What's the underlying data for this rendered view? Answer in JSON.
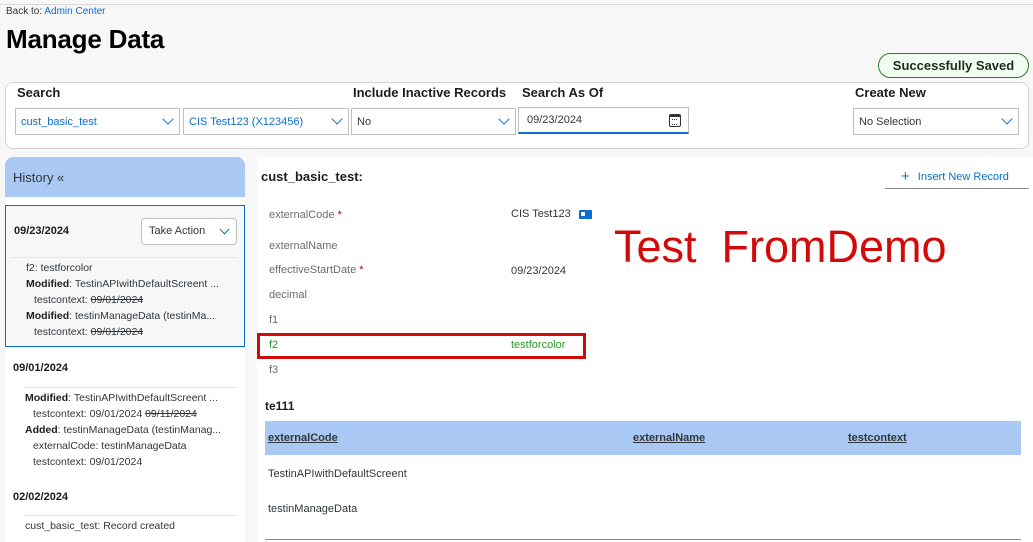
{
  "header": {
    "back_prefix": "Back to:",
    "back_link": "Admin Center",
    "title": "Manage Data",
    "status_badge": "Successfully Saved"
  },
  "search": {
    "search_label": "Search",
    "object_type": "cust_basic_test",
    "object_instance": "CIS Test123 (X123456)",
    "inactive_label": "Include Inactive Records",
    "inactive_value": "No",
    "asof_label": "Search As Of",
    "asof_value": "09/23/2024",
    "create_label": "Create New",
    "create_value": "No Selection"
  },
  "history": {
    "header": "History «",
    "take_action": "Take Action",
    "entries": [
      {
        "date": "09/23/2024",
        "lines": [
          {
            "text": "f2: testforcolor"
          },
          {
            "bold": "Modified",
            "text": ": TestinAPIwithDefaultScreent ..."
          },
          {
            "text": "testcontext: ",
            "strike": "09/01/2024"
          },
          {
            "bold": "Modified",
            "text": ": testinManageData (testinMa..."
          },
          {
            "text": "testcontext: ",
            "strike": "09/01/2024"
          }
        ]
      },
      {
        "date": "09/01/2024",
        "lines": [
          {
            "bold": "Modified",
            "text": ": TestinAPIwithDefaultScreent ..."
          },
          {
            "text": "testcontext: 09/01/2024 ",
            "strike": "09/11/2024"
          },
          {
            "bold": "Added",
            "text": ": testinManageData (testinManag..."
          },
          {
            "text": "externalCode: testinManageData"
          },
          {
            "text": "testcontext: 09/01/2024"
          }
        ]
      },
      {
        "date": "02/02/2024",
        "lines": [
          {
            "text": "cust_basic_test: Record created"
          }
        ]
      }
    ]
  },
  "record": {
    "title": "cust_basic_test:",
    "insert_button": "Insert New Record",
    "fields": [
      {
        "label": "externalCode",
        "required": "*",
        "value": "CIS Test123"
      },
      {
        "label": "externalName",
        "value": ""
      },
      {
        "label": "effectiveStartDate",
        "required": "*",
        "value": "09/23/2024"
      },
      {
        "label": "decimal",
        "value": ""
      },
      {
        "label": "f1",
        "value": ""
      },
      {
        "label": "f2",
        "value": "testforcolor"
      },
      {
        "label": "f3",
        "value": ""
      }
    ],
    "overlay_text": "Test  FromDemo"
  },
  "child_table": {
    "title": "te111",
    "columns": [
      "externalCode",
      "externalName",
      "testcontext"
    ],
    "rows": [
      [
        "TestinAPIwithDefaultScreent",
        "",
        ""
      ],
      [
        "testinManageData",
        "",
        ""
      ]
    ]
  },
  "colors": {
    "accent": "#0a6ed1",
    "highlight_panel": "#a9c8f4",
    "annotation_red": "#d20a0a",
    "changed_field_green": "#2b9a2b"
  }
}
